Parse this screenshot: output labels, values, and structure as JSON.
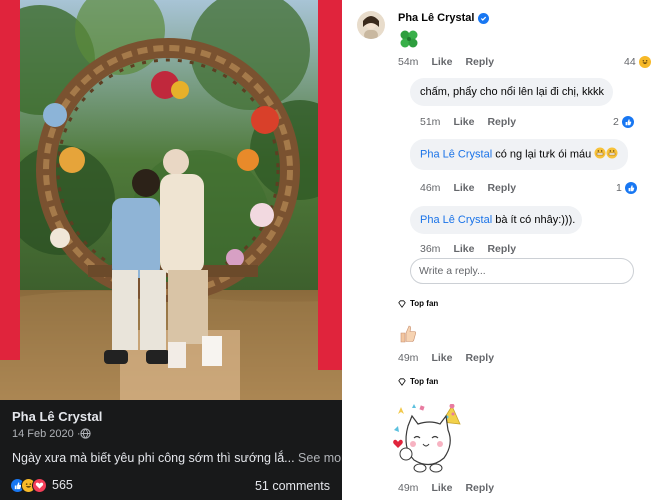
{
  "post": {
    "author": "Pha Lê Crystal",
    "date": "14 Feb 2020 · ",
    "caption": "Ngày xưa mà biết yêu phi công sớm thì sướng lắ...",
    "see_more": "See more",
    "reaction_count": "565",
    "comment_count": "51 comments",
    "reactions": [
      "like-icon",
      "haha-icon",
      "love-icon"
    ]
  },
  "comments": {
    "top": {
      "author": "Pha Lê Crystal",
      "content_icon": "four-leaf-clover-icon",
      "time": "54m",
      "like": "Like",
      "reply": "Reply",
      "reaction_count": "44"
    },
    "replies": [
      {
        "text": "chấm, phẩy cho nổi lên lại đi chị, kkkk",
        "time": "51m",
        "like": "Like",
        "reply": "Reply",
        "reaction_count": "2"
      },
      {
        "mention": "Pha Lê Crystal",
        "text": " có ng lại tưk ói máu ",
        "time": "46m",
        "like": "Like",
        "reply": "Reply",
        "reaction_count": "1"
      },
      {
        "mention": "Pha Lê Crystal",
        "text": " bà ít có nhây:))).",
        "time": "36m",
        "like": "Like",
        "reply": "Reply"
      }
    ],
    "write_reply_placeholder": "Write a reply...",
    "fan_comments": [
      {
        "badge": "Top fan",
        "sticker": "thumbs-up-sticker",
        "time": "49m",
        "like": "Like",
        "reply": "Reply"
      },
      {
        "badge": "Top fan",
        "sticker": "cat-sticker",
        "time": "49m",
        "like": "Like",
        "reply": "Reply"
      }
    ]
  },
  "colors": {
    "dark_bg": "#18191a",
    "link_blue": "#1a73e8",
    "bubble_grey": "#f0f2f5",
    "meta_grey": "#65676b",
    "red_pillar": "#e0243c"
  }
}
